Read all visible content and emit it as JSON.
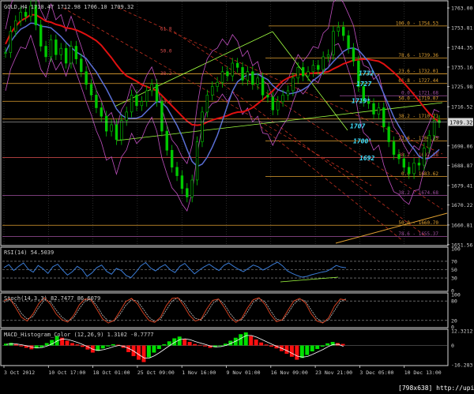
{
  "colors": {
    "background": "#000000",
    "frame": "#d9d9d9",
    "grid": "#6b6b6b",
    "text": "#d0d0d0",
    "candles_up": "#00c800",
    "candles_down": "#00c800",
    "ma_red": "#e01010",
    "ma_blue": "#5a6fd6",
    "bands_magenta": "#c050c0",
    "fib_orange": "#e0a030",
    "fib_magenta": "#a050a0",
    "trend_green": "#a0ff40",
    "channel_red": "#c03020",
    "levels_cyan": "#40e0ff",
    "rsi_line": "#3a7bd5",
    "stoch_main": "#d04020",
    "stoch_signal": "#c0c0c0",
    "macd_up": "#00e000",
    "macd_down": "#ff1010"
  },
  "header": {
    "main": "GOLD,H4  1710.47 1712.98 1706.10 1709.32",
    "rsi": "RSI(14) 54.5039",
    "stoch": "Stoch(14,3,3) 82.7477 86.6079",
    "macd": "MACD_Histogram_Color (12,26,9)  1.3102 -0.7777"
  },
  "watermark": "[798x638]  http://upic.me/",
  "chart_data": [
    {
      "name": "price",
      "type": "line",
      "symbol": "GOLD",
      "timeframe": "H4",
      "ohlc_header": {
        "open": 1710.47,
        "high": 1712.98,
        "low": 1706.1,
        "close": 1709.32
      },
      "current_price": 1709.32,
      "ylim": [
        1651.5,
        1766.0
      ],
      "y_ticks": [
        1763.0,
        1753.81,
        1744.35,
        1735.16,
        1725.98,
        1716.52,
        1698.06,
        1688.87,
        1679.41,
        1670.22,
        1660.81,
        1651.56
      ],
      "x_ticks": [
        "3 Oct 2012",
        "10 Oct 17:00",
        "18 Oct 01:00",
        "25 Oct 09:00",
        "1 Nov 16:00",
        "9 Nov 01:00",
        "16 Nov 09:00",
        "23 Nov 21:00",
        "3 Dec 05:00",
        "10 Dec 13:00"
      ],
      "close_series": [
        1742,
        1752,
        1757,
        1761,
        1759,
        1764,
        1755,
        1745,
        1740,
        1748,
        1741,
        1744,
        1737,
        1745,
        1739,
        1733,
        1727,
        1722,
        1716,
        1712,
        1705,
        1708,
        1701,
        1710,
        1714,
        1722,
        1717,
        1719,
        1724,
        1727,
        1719,
        1705,
        1696,
        1688,
        1684,
        1678,
        1674,
        1682,
        1700,
        1714,
        1722,
        1726,
        1728,
        1733,
        1731,
        1737,
        1735,
        1729,
        1733,
        1727,
        1730,
        1722,
        1721,
        1715,
        1719,
        1722,
        1724,
        1730,
        1735,
        1731,
        1733,
        1736,
        1734,
        1740,
        1741,
        1752,
        1754,
        1750,
        1744,
        1738,
        1726,
        1719,
        1718,
        1713,
        1716,
        1707,
        1700,
        1694,
        1692,
        1688,
        1685,
        1690,
        1689,
        1697,
        1703,
        1710,
        1709
      ],
      "fib_levels": [
        {
          "label": "100.0 - 1754.53",
          "value": 1754.53,
          "color": "#e0a030"
        },
        {
          "label": "78.6 - 1739.36",
          "value": 1739.36,
          "color": "#e0a030"
        },
        {
          "label": "23.6 - 1732.01",
          "value": 1732.01,
          "color": "#e0a030"
        },
        {
          "label": "61.8 - 1727.44",
          "value": 1727.44,
          "color": "#e0a030"
        },
        {
          "label": "0.0 - 1721.68",
          "value": 1721.68,
          "color": "#a050a0"
        },
        {
          "label": "50.0 - 1719.07",
          "value": 1719.07,
          "color": "#e0a030"
        },
        {
          "label": "38.2 - 1710.71",
          "value": 1710.71,
          "color": "#e0a030"
        },
        {
          "label": "23.6 - 1700.35",
          "value": 1700.35,
          "color": "#e0a030"
        },
        {
          "label": "38.2 - 1692.58",
          "value": 1692.58,
          "color": "#e05050"
        },
        {
          "label": "0.0 - 1683.62",
          "value": 1683.62,
          "color": "#e0a030"
        },
        {
          "label": "38.2 - 1674.68",
          "value": 1674.68,
          "color": "#a050a0"
        },
        {
          "label": "50.0 - 1660.70",
          "value": 1660.7,
          "color": "#e0a030"
        },
        {
          "label": "78.6 - 1655.37",
          "value": 1655.37,
          "color": "#a050a0"
        }
      ],
      "left_fib_labels": [
        {
          "label": "61.8",
          "value": 1752.5
        },
        {
          "label": "50.0",
          "value": 1742.0
        },
        {
          "label": "38.2",
          "value": 1731.5
        },
        {
          "label": "23.6",
          "value": 1718.0
        }
      ],
      "key_levels": [
        {
          "label": "1732",
          "value": 1732.0
        },
        {
          "label": "1727",
          "value": 1727.0
        },
        {
          "label": "1719*",
          "value": 1719.0
        },
        {
          "label": "1707",
          "value": 1707.0
        },
        {
          "label": "1700'",
          "value": 1700.0
        },
        {
          "label": "1692",
          "value": 1692.0
        }
      ]
    },
    {
      "name": "rsi",
      "type": "line",
      "title": "RSI(14) 54.5039",
      "ylim": [
        0,
        100
      ],
      "y_ticks": [
        100,
        70,
        50,
        30,
        0
      ],
      "levels": [
        70,
        50,
        30
      ],
      "values": [
        55,
        62,
        48,
        58,
        66,
        51,
        44,
        60,
        52,
        41,
        57,
        63,
        49,
        37,
        45,
        58,
        50,
        34,
        42,
        55,
        61,
        46,
        39,
        53,
        48,
        36,
        31,
        44,
        59,
        67,
        54,
        47,
        56,
        62,
        50,
        43,
        58,
        65,
        52,
        40,
        49,
        57,
        63,
        55,
        48,
        60,
        66,
        58,
        51,
        45,
        53,
        61,
        57,
        49,
        55,
        62,
        68,
        59,
        47,
        41,
        36,
        32,
        34,
        38,
        41,
        44,
        46,
        52,
        60,
        56,
        54.5
      ]
    },
    {
      "name": "stochastic",
      "type": "line",
      "title": "Stoch(14,3,3) 82.7477 86.6079",
      "ylim": [
        0,
        100
      ],
      "y_ticks": [
        100,
        80,
        20,
        0
      ],
      "levels": [
        80,
        20
      ],
      "series": [
        {
          "values": [
            80,
            88,
            60,
            30,
            18,
            40,
            72,
            90,
            70,
            40,
            22,
            15,
            35,
            68,
            86,
            84,
            55,
            25,
            12,
            20,
            48,
            78,
            88,
            72,
            44,
            20,
            14,
            30,
            66,
            88,
            90,
            66,
            36,
            18,
            24,
            56,
            82,
            86,
            60,
            30,
            14,
            26,
            58,
            84,
            90,
            70,
            38,
            16,
            22,
            52,
            80,
            88,
            74,
            40,
            18,
            12,
            28,
            64,
            86,
            82.7
          ]
        },
        {
          "values": [
            76,
            84,
            70,
            42,
            24,
            32,
            60,
            84,
            78,
            52,
            30,
            18,
            28,
            56,
            80,
            86,
            66,
            36,
            18,
            18,
            38,
            66,
            84,
            80,
            56,
            30,
            16,
            24,
            52,
            80,
            90,
            76,
            48,
            26,
            22,
            42,
            72,
            86,
            70,
            42,
            20,
            22,
            46,
            76,
            88,
            78,
            50,
            24,
            20,
            42,
            70,
            86,
            80,
            52,
            26,
            14,
            22,
            50,
            78,
            86.6
          ]
        }
      ]
    },
    {
      "name": "macd_histogram",
      "type": "bar",
      "title": "MACD_Histogram_Color (12,26,9)  1.3102 -0.7777",
      "y_ticks": [
        12.3212,
        0.0,
        -16.283
      ],
      "ylim": [
        -16.283,
        12.3212
      ],
      "histogram": [
        1.5,
        2.2,
        1.0,
        -0.8,
        -2.0,
        -3.2,
        -2.4,
        -1.5,
        2.0,
        4.6,
        8.0,
        6.5,
        4.0,
        2.0,
        0.9,
        -1.2,
        -3.4,
        -6.0,
        -4.5,
        -2.5,
        -0.8,
        1.0,
        0.6,
        -2.0,
        -5.6,
        -9.0,
        -12.0,
        -14.0,
        -10.0,
        -6.0,
        -3.0,
        1.0,
        3.5,
        6.0,
        7.5,
        5.5,
        3.0,
        1.2,
        0.5,
        -0.8,
        -2.0,
        -1.5,
        -0.6,
        1.5,
        4.0,
        6.5,
        9.5,
        11.0,
        8.0,
        5.0,
        2.5,
        0.8,
        -1.0,
        -2.5,
        -4.8,
        -7.0,
        -9.5,
        -12.0,
        -10.5,
        -8.0,
        -5.0,
        -3.0,
        -1.0,
        1.8,
        3.0,
        2.0,
        1.3
      ],
      "signal": [
        1.0,
        1.3,
        1.2,
        0.6,
        -0.3,
        -1.4,
        -2.0,
        -1.7,
        -0.4,
        1.5,
        4.0,
        5.5,
        5.0,
        3.8,
        2.4,
        0.7,
        -1.2,
        -3.4,
        -4.2,
        -3.6,
        -2.4,
        -1.0,
        0.0,
        -0.7,
        -2.6,
        -5.0,
        -8.0,
        -10.6,
        -10.5,
        -8.6,
        -6.0,
        -3.0,
        0.0,
        2.8,
        5.0,
        5.6,
        4.8,
        3.3,
        2.0,
        0.8,
        -0.6,
        -1.2,
        -1.0,
        0.0,
        1.8,
        3.8,
        6.2,
        8.4,
        8.4,
        7.0,
        5.0,
        3.0,
        1.0,
        -0.8,
        -2.6,
        -4.6,
        -6.8,
        -9.0,
        -9.8,
        -9.2,
        -7.4,
        -5.4,
        -3.4,
        -1.0,
        0.8,
        1.0,
        -0.78
      ]
    }
  ]
}
